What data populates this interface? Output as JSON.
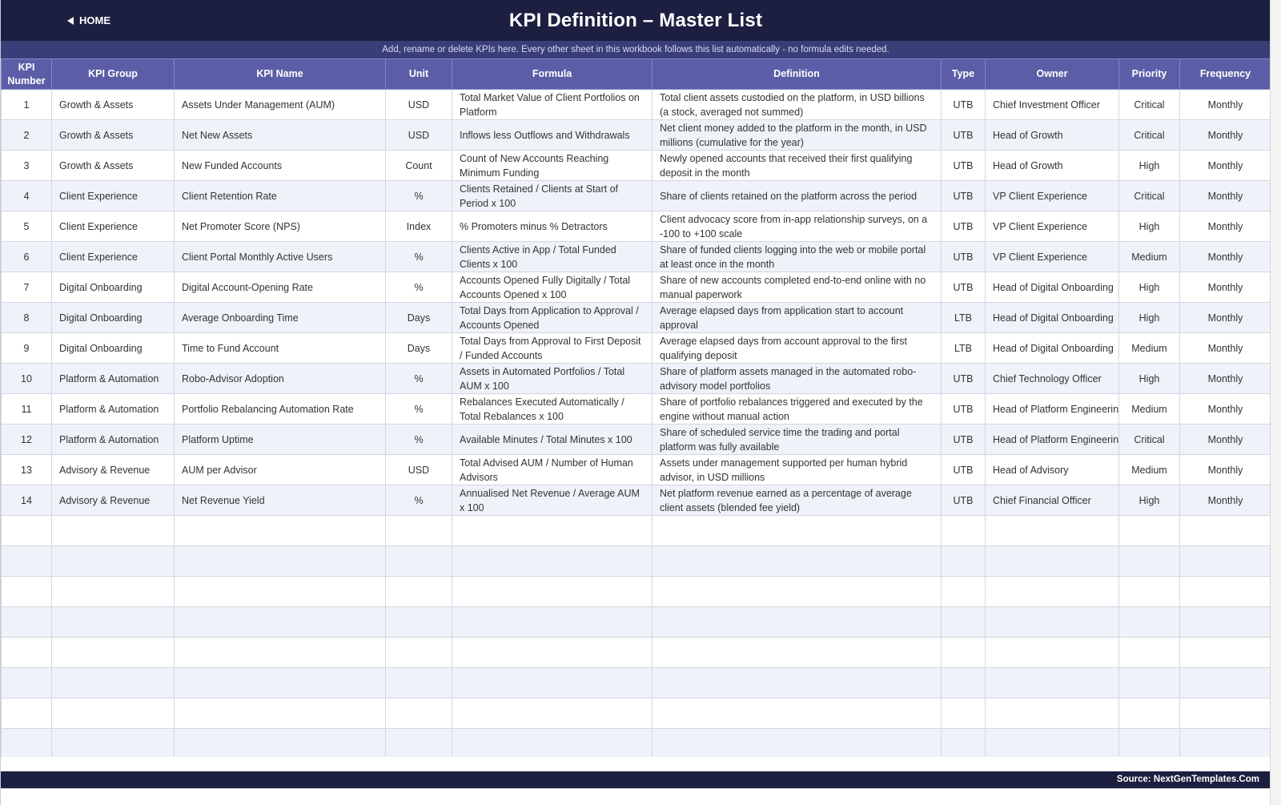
{
  "header": {
    "home_label": "HOME",
    "title": "KPI Definition  –  Master List",
    "instructions": "Add, rename or delete KPIs here. Every other sheet in this workbook follows this list automatically - no formula edits needed."
  },
  "table": {
    "columns": [
      "KPI Number",
      "KPI Group",
      "KPI Name",
      "Unit",
      "Formula",
      "Definition",
      "Type",
      "Owner",
      "Priority",
      "Frequency"
    ],
    "rows": [
      [
        "1",
        "Growth & Assets",
        "Assets Under Management (AUM)",
        "USD",
        "Total Market Value of Client Portfolios on Platform",
        "Total client assets custodied on the platform, in USD billions (a stock, averaged not summed)",
        "UTB",
        "Chief Investment Officer",
        "Critical",
        "Monthly"
      ],
      [
        "2",
        "Growth & Assets",
        "Net New Assets",
        "USD",
        "Inflows less Outflows and Withdrawals",
        "Net client money added to the platform in the month, in USD millions (cumulative for the year)",
        "UTB",
        "Head of Growth",
        "Critical",
        "Monthly"
      ],
      [
        "3",
        "Growth & Assets",
        "New Funded Accounts",
        "Count",
        "Count of New Accounts Reaching Minimum Funding",
        "Newly opened accounts that received their first qualifying deposit in the month",
        "UTB",
        "Head of Growth",
        "High",
        "Monthly"
      ],
      [
        "4",
        "Client Experience",
        "Client Retention Rate",
        "%",
        "Clients Retained / Clients at Start of Period x 100",
        "Share of clients retained on the platform across the period",
        "UTB",
        "VP Client Experience",
        "Critical",
        "Monthly"
      ],
      [
        "5",
        "Client Experience",
        "Net Promoter Score (NPS)",
        "Index",
        "% Promoters minus % Detractors",
        "Client advocacy score from in-app relationship surveys, on a -100 to +100 scale",
        "UTB",
        "VP Client Experience",
        "High",
        "Monthly"
      ],
      [
        "6",
        "Client Experience",
        "Client Portal Monthly Active Users",
        "%",
        "Clients Active in App / Total Funded Clients x 100",
        "Share of funded clients logging into the web or mobile portal at least once in the month",
        "UTB",
        "VP Client Experience",
        "Medium",
        "Monthly"
      ],
      [
        "7",
        "Digital Onboarding",
        "Digital Account-Opening Rate",
        "%",
        "Accounts Opened Fully Digitally / Total Accounts Opened x 100",
        "Share of new accounts completed end-to-end online with no manual paperwork",
        "UTB",
        "Head of Digital Onboarding",
        "High",
        "Monthly"
      ],
      [
        "8",
        "Digital Onboarding",
        "Average Onboarding Time",
        "Days",
        "Total Days from Application to Approval / Accounts Opened",
        "Average elapsed days from application start to account approval",
        "LTB",
        "Head of Digital Onboarding",
        "High",
        "Monthly"
      ],
      [
        "9",
        "Digital Onboarding",
        "Time to Fund Account",
        "Days",
        "Total Days from Approval to First Deposit / Funded Accounts",
        "Average elapsed days from account approval to the first qualifying deposit",
        "LTB",
        "Head of Digital Onboarding",
        "Medium",
        "Monthly"
      ],
      [
        "10",
        "Platform & Automation",
        "Robo-Advisor Adoption",
        "%",
        "Assets in Automated Portfolios / Total AUM x 100",
        "Share of platform assets managed in the automated robo-advisory model portfolios",
        "UTB",
        "Chief Technology Officer",
        "High",
        "Monthly"
      ],
      [
        "11",
        "Platform & Automation",
        "Portfolio Rebalancing Automation Rate",
        "%",
        "Rebalances Executed Automatically / Total Rebalances x 100",
        "Share of portfolio rebalances triggered and executed by the engine without manual action",
        "UTB",
        "Head of Platform Engineering",
        "Medium",
        "Monthly"
      ],
      [
        "12",
        "Platform & Automation",
        "Platform Uptime",
        "%",
        "Available Minutes / Total Minutes x 100",
        "Share of scheduled service time the trading and portal platform was fully available",
        "UTB",
        "Head of Platform Engineering",
        "Critical",
        "Monthly"
      ],
      [
        "13",
        "Advisory & Revenue",
        "AUM per Advisor",
        "USD",
        "Total Advised AUM / Number of Human Advisors",
        "Assets under management supported per human hybrid advisor, in USD millions",
        "UTB",
        "Head of Advisory",
        "Medium",
        "Monthly"
      ],
      [
        "14",
        "Advisory & Revenue",
        "Net Revenue Yield",
        "%",
        "Annualised Net Revenue / Average AUM x 100",
        "Net platform revenue earned as a percentage of average client assets (blended fee yield)",
        "UTB",
        "Chief Financial Officer",
        "High",
        "Monthly"
      ]
    ],
    "empty_rows": 8
  },
  "footer": {
    "source": "Source: NextGenTemplates.Com"
  },
  "colors": {
    "title_bar": "#1c1f3f",
    "subtitle_bar": "#393d78",
    "header_row": "#5b5ea6",
    "zebra_row": "#eff3f9"
  },
  "icons": {
    "home": "left-triangle-icon"
  }
}
